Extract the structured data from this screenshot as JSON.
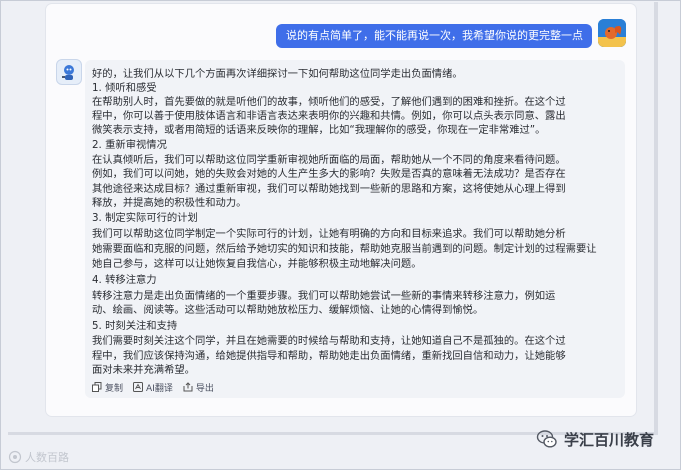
{
  "conversation": {
    "user_message": "说的有点简单了，能不能再说一次，我希望你说的更完整一点",
    "assistant_lines": [
      "好的，让我们从以下几个方面再次详细探讨一下如何帮助这位同学走出负面情绪。",
      "1. 倾听和感受",
      "在帮助别人时，首先要做的就是听他们的故事，倾听他们的感受，了解他们遇到的困难和挫折。在这个过",
      "程中，你可以善于使用肢体语言和非语言表达来表明你的兴趣和共情。例如，你可以点头表示同意、露出",
      "微笑表示支持，或者用简短的话语来反映你的理解，比如“我理解你的感受，你现在一定非常难过”。",
      "2. 重新审视情况",
      "在认真倾听后，我们可以帮助这位同学重新审视她所面临的局面，帮助她从一个不同的角度来看待问题。",
      "例如，我们可以问她，她的失败会对她的人生产生多大的影响？失败是否真的意味着无法成功？是否存在",
      "其他途径来达成目标？通过重新审视，我们可以帮助她找到一些新的思路和方案，这将使她从心理上得到",
      "释放，并提高她的积极性和动力。",
      "3. 制定实际可行的计划",
      "我们可以帮助这位同学制定一个实际可行的计划，让她有明确的方向和目标来追求。我们可以帮助她分析",
      "她需要面临和克服的问题，然后给予她切实的知识和技能，帮助她克服当前遇到的问题。制定计划的过程需要让",
      "她自己参与，这样可以让她恢复自我信心，并能够积极主动地解决问题。",
      "4. 转移注意力",
      "转移注意力是走出负面情绪的一个重要步骤。我们可以帮助她尝试一些新的事情来转移注意力，例如运",
      "动、绘画、阅读等。这些活动可以帮助她放松压力、缓解烦恼、让她的心情得到愉悦。",
      "5. 时刻关注和支持",
      "我们需要时刻关注这个同学，并且在她需要的时候给与帮助和支持，让她知道自己不是孤独的。在这个过",
      "程中，我们应该保持沟通，给她提供指导和帮助，帮助她走出负面情绪，重新找回自信和动力，让她能够",
      "面对未来并充满希望。"
    ],
    "actions": [
      {
        "label": "复制",
        "icon": "copy-icon"
      },
      {
        "label": "AI翻译",
        "icon": "translate-icon"
      },
      {
        "label": "导出",
        "icon": "export-icon"
      }
    ]
  },
  "watermarks": {
    "left": "人数百路",
    "right": "学汇百川教育"
  },
  "colors": {
    "user_bubble": "#3f6ee9",
    "bot_bubble": "#f1f3f7",
    "text": "#2a2d33"
  }
}
